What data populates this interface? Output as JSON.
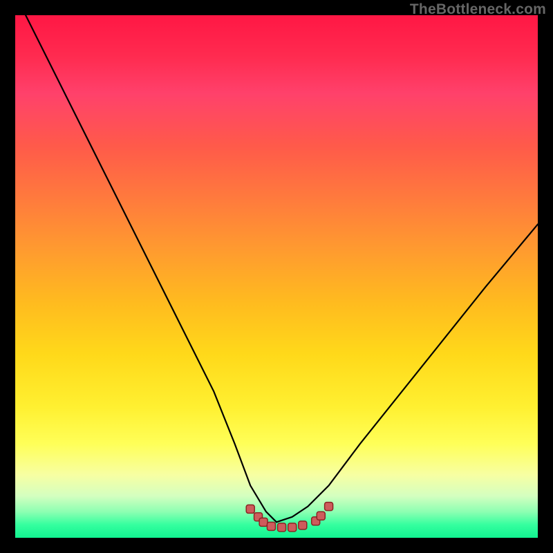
{
  "watermark": "TheBottleneck.com",
  "colors": {
    "background": "#000000",
    "curve": "#000000",
    "dot_fill": "#cd5c5c",
    "dot_stroke": "#8b2323",
    "gradient_top": "#ff1744",
    "gradient_bottom": "#11f390"
  },
  "chart_data": {
    "type": "line",
    "title": "",
    "xlabel": "",
    "ylabel": "",
    "xlim": [
      0,
      100
    ],
    "ylim": [
      0,
      100
    ],
    "series": [
      {
        "name": "curve-left",
        "x": [
          2,
          10,
          18,
          26,
          32,
          38,
          42,
          45,
          48,
          50
        ],
        "y": [
          100,
          84,
          68,
          52,
          40,
          28,
          18,
          10,
          5,
          3
        ]
      },
      {
        "name": "curve-right",
        "x": [
          50,
          53,
          56,
          60,
          66,
          74,
          82,
          90,
          100
        ],
        "y": [
          3,
          4,
          6,
          10,
          18,
          28,
          38,
          48,
          60
        ]
      }
    ],
    "dots": {
      "name": "bottom-cluster",
      "x": [
        45,
        46.5,
        47.5,
        49,
        51,
        53,
        55,
        57.5,
        58.5,
        60
      ],
      "y": [
        5.5,
        4.0,
        3.0,
        2.2,
        2.0,
        2.0,
        2.4,
        3.2,
        4.2,
        6.0
      ]
    },
    "annotations": []
  }
}
